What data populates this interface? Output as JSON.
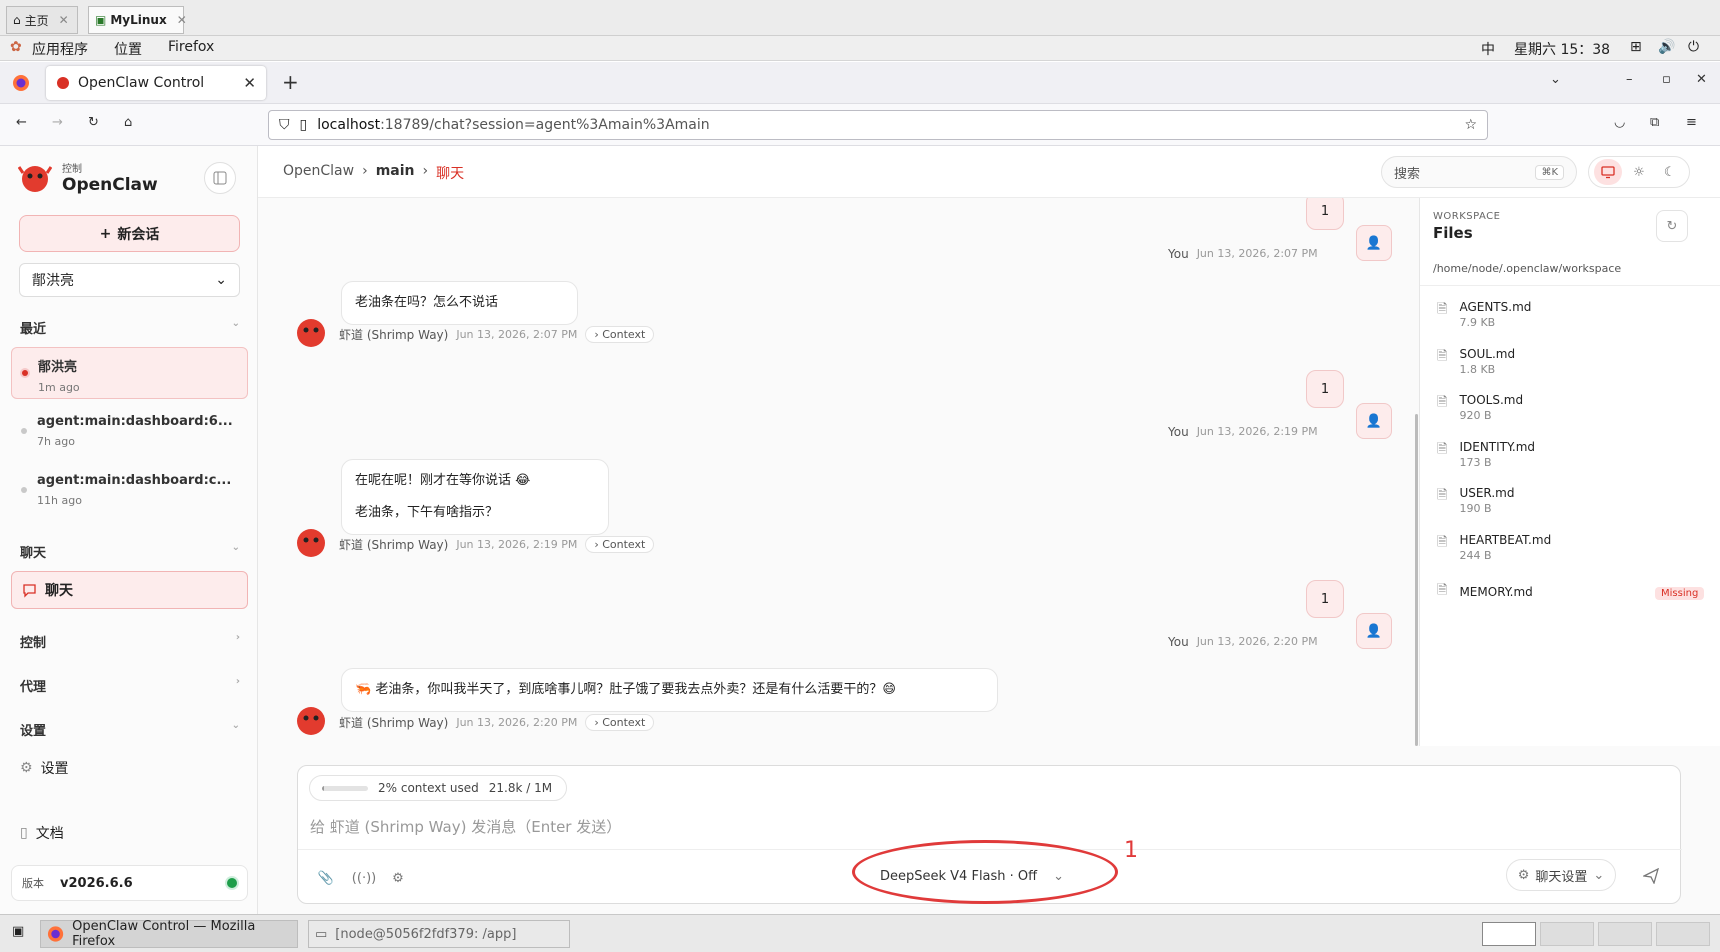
{
  "os": {
    "tabs": [
      {
        "label": "主页",
        "icon": "home-icon",
        "active": false
      },
      {
        "label": "MyLinux",
        "icon": "vm-icon",
        "active": true
      }
    ],
    "menu": {
      "apps": "应用程序",
      "places": "位置",
      "firefox": "Firefox"
    },
    "status": {
      "ime": "中",
      "datetime": "星期六 15：38"
    }
  },
  "browser": {
    "tab_title": "OpenClaw Control",
    "url_host": "localhost",
    "url_path": ":18789/chat?session=agent%3Amain%3Amain"
  },
  "sidebar": {
    "logo_sub": "控制",
    "logo_title": "OpenClaw",
    "new_session": "新会话",
    "agent_selected": "鄁洪亮",
    "sections": {
      "recent": "最近",
      "chat": "聊天",
      "control": "控制",
      "agent": "代理",
      "settings": "设置"
    },
    "sessions": [
      {
        "name": "鄁洪亮",
        "time": "1m ago",
        "active": true
      },
      {
        "name": "agent:main:dashboard:6...",
        "time": "7h ago",
        "active": false
      },
      {
        "name": "agent:main:dashboard:c...",
        "time": "11h ago",
        "active": false
      }
    ],
    "chat_item": "聊天",
    "settings_item": "设置",
    "docs_item": "文档",
    "version_label": "版本",
    "version_value": "v2026.6.6"
  },
  "topbar": {
    "crumb_root": "OpenClaw",
    "crumb_mid": "main",
    "crumb_current": "聊天",
    "search_label": "搜索",
    "search_kbd": "⌘K"
  },
  "chat": {
    "user_name": "You",
    "agent_name": "虾道 (Shrimp Way)",
    "context_label": "Context",
    "messages": [
      {
        "role": "user",
        "text": "1",
        "time": "Jun 13, 2026, 2:07 PM"
      },
      {
        "role": "agent",
        "lines": [
          "老油条在吗？怎么不说话"
        ],
        "time": "Jun 13, 2026, 2:07 PM"
      },
      {
        "role": "user",
        "text": "1",
        "time": "Jun 13, 2026, 2:19 PM"
      },
      {
        "role": "agent",
        "lines": [
          "在呢在呢！刚才在等你说话 😂",
          "老油条，下午有啥指示？"
        ],
        "time": "Jun 13, 2026, 2:19 PM"
      },
      {
        "role": "user",
        "text": "1",
        "time": "Jun 13, 2026, 2:20 PM"
      },
      {
        "role": "agent",
        "lines": [
          "🦐 老油条，你叫我半天了，到底啥事儿啊？肚子饿了要我去点外卖？还是有什么活要干的？😄"
        ],
        "time": "Jun 13, 2026, 2:20 PM"
      }
    ]
  },
  "workspace": {
    "label": "WORKSPACE",
    "title": "Files",
    "path": "/home/node/.openclaw/workspace",
    "missing_label": "Missing",
    "files": [
      {
        "name": "AGENTS.md",
        "size": "7.9 KB"
      },
      {
        "name": "SOUL.md",
        "size": "1.8 KB"
      },
      {
        "name": "TOOLS.md",
        "size": "920 B"
      },
      {
        "name": "IDENTITY.md",
        "size": "173 B"
      },
      {
        "name": "USER.md",
        "size": "190 B"
      },
      {
        "name": "HEARTBEAT.md",
        "size": "244 B"
      },
      {
        "name": "MEMORY.md",
        "size": ""
      }
    ]
  },
  "composer": {
    "context_used": "2% context used",
    "context_tokens": "21.8k / 1M",
    "context_fraction": 0.02,
    "placeholder": "给 虾道 (Shrimp Way) 发消息（Enter 发送）",
    "model": "DeepSeek V4 Flash · Off",
    "chat_settings": "聊天设置"
  },
  "annotation": {
    "number": "1",
    "color": "#e03a3a"
  },
  "taskbar": {
    "firefox_task": "OpenClaw Control — Mozilla Firefox",
    "terminal_task": "[node@5056f2fdf379: /app]"
  },
  "colors": {
    "accent": "#d93025",
    "accent_soft": "#fdecec",
    "online": "#1e9e4a"
  }
}
